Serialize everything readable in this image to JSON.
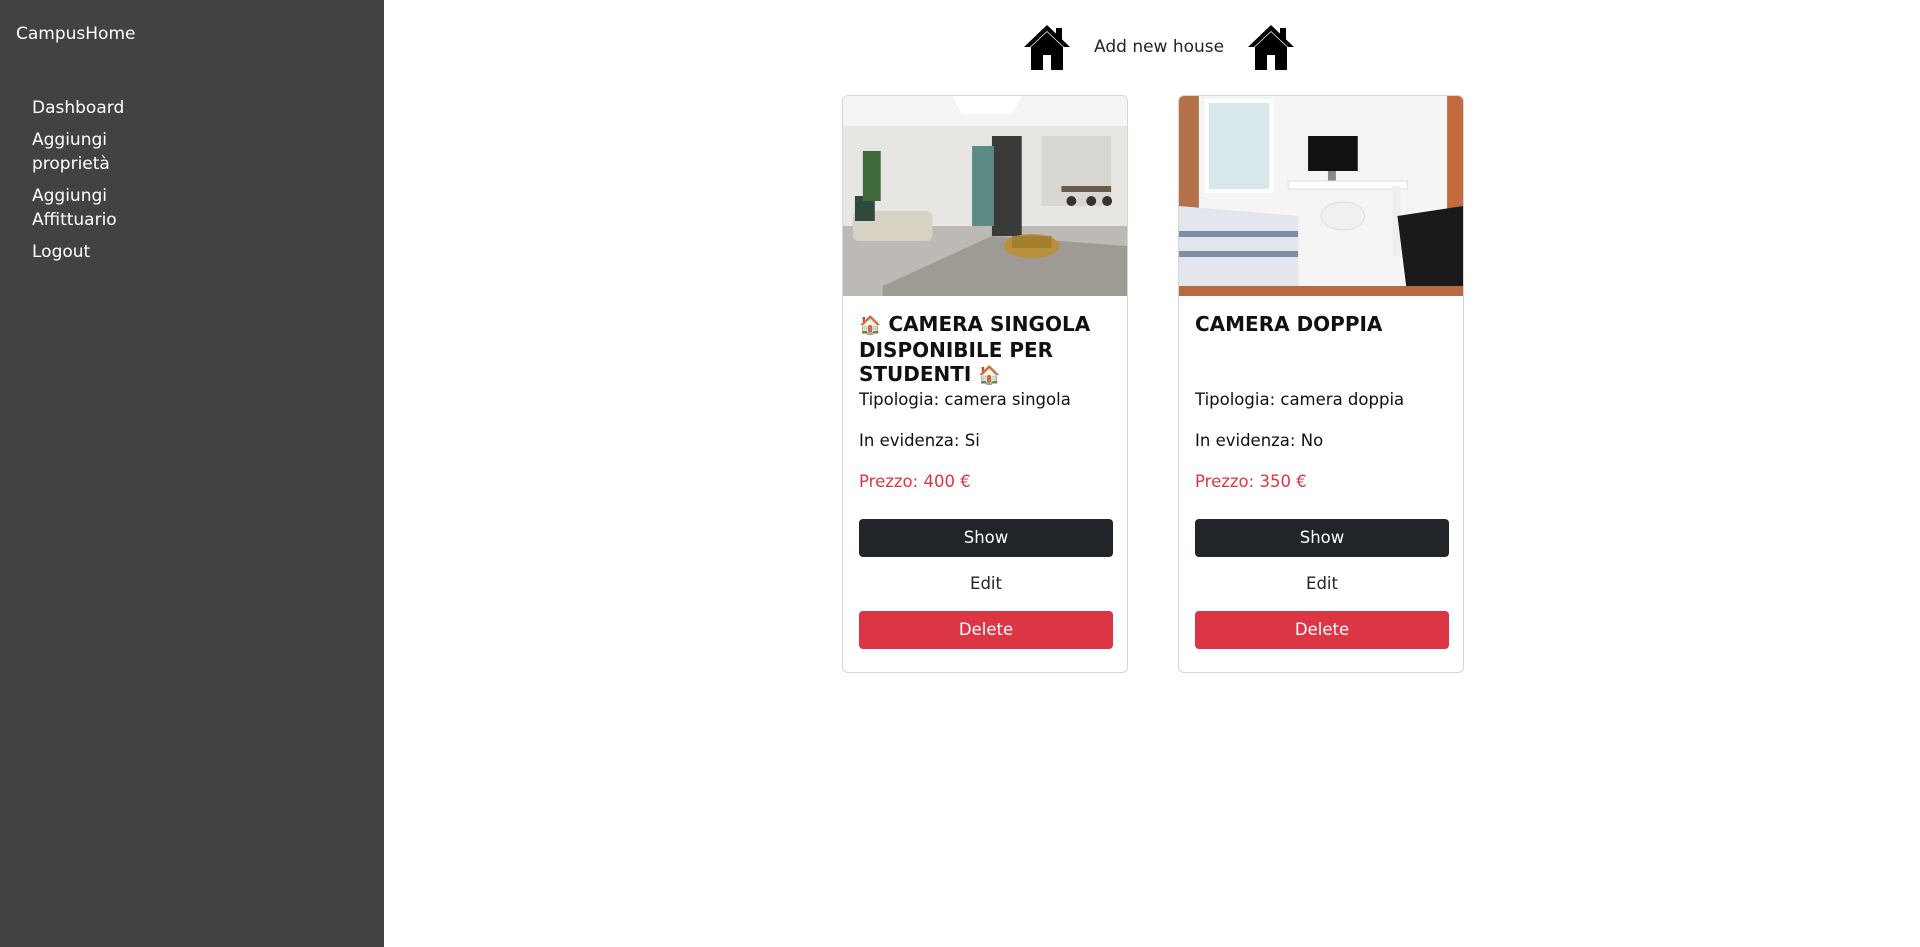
{
  "sidebar": {
    "brand": "CampusHome",
    "items": [
      {
        "label": "Dashboard"
      },
      {
        "label": "Aggiungi proprietà"
      },
      {
        "label": "Aggiungi Affittuario"
      },
      {
        "label": "Logout"
      }
    ]
  },
  "header": {
    "add_label": "Add new house",
    "icon": "house-icon"
  },
  "cards": [
    {
      "title_prefix": "🏠",
      "title": "CAMERA SINGOLA DISPONIBILE PER STUDENTI",
      "title_suffix": "🏠",
      "tipologia": "Tipologia: camera singola",
      "evidenza": "In evidenza: Si",
      "prezzo": "Prezzo: 400 €",
      "show_label": "Show",
      "edit_label": "Edit",
      "delete_label": "Delete"
    },
    {
      "title_prefix": "",
      "title": "CAMERA DOPPIA",
      "title_suffix": "",
      "tipologia": "Tipologia: camera doppia",
      "evidenza": "In evidenza: No",
      "prezzo": "Prezzo: 350 €",
      "show_label": "Show",
      "edit_label": "Edit",
      "delete_label": "Delete"
    }
  ],
  "colors": {
    "sidebar_bg": "#424242",
    "dark_button": "#212529",
    "danger": "#dc3545"
  }
}
